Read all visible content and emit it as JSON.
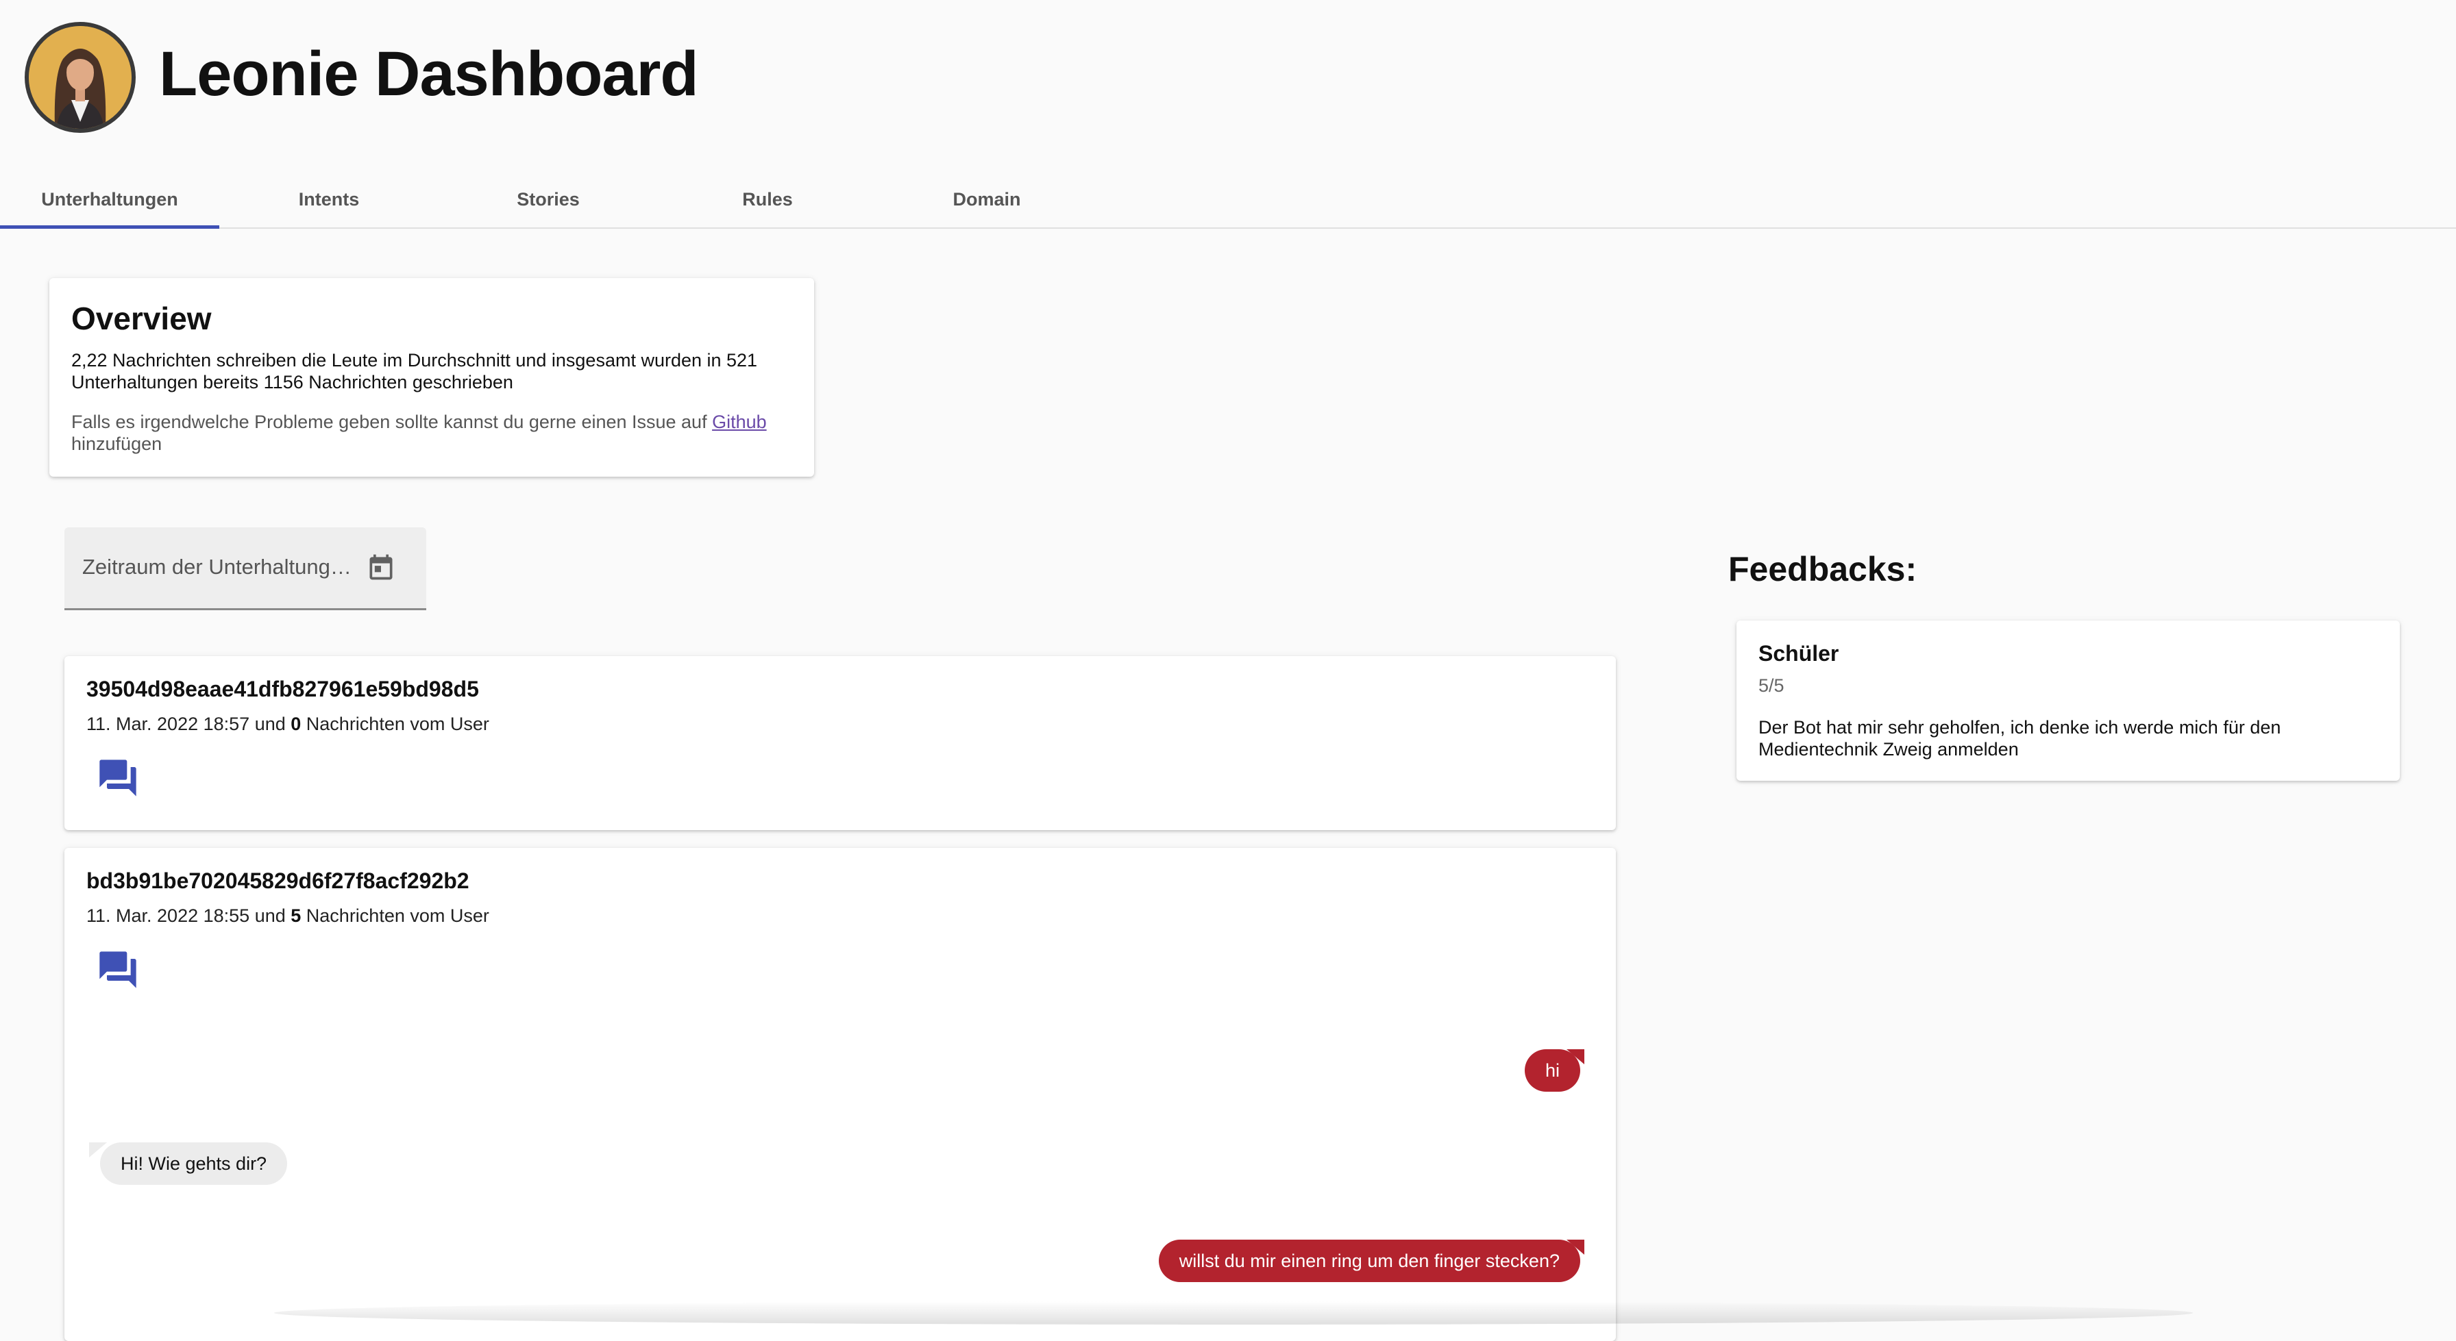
{
  "app": {
    "title": "Leonie Dashboard"
  },
  "tabs": [
    {
      "label": "Unterhaltungen",
      "active": true
    },
    {
      "label": "Intents",
      "active": false
    },
    {
      "label": "Stories",
      "active": false
    },
    {
      "label": "Rules",
      "active": false
    },
    {
      "label": "Domain",
      "active": false
    }
  ],
  "overview": {
    "title": "Overview",
    "stats_text": "2,22 Nachrichten schreiben die Leute im Durchschnitt und insgesamt wurden in 521 Unterhaltungen bereits 1156 Nachrichten geschrieben",
    "note_prefix": "Falls es irgendwelche Probleme geben sollte kannst du gerne einen Issue auf ",
    "note_link": "Github",
    "note_suffix": " hinzufügen"
  },
  "date_filter": {
    "placeholder": "Zeitraum der Unterhaltung…",
    "icon": "calendar-icon"
  },
  "conversations": [
    {
      "id": "39504d98eaae41dfb827961e59bd98d5",
      "datetime": "11. Mar. 2022 18:57",
      "connector": " und ",
      "count": "0",
      "count_suffix": " Nachrichten vom User",
      "messages": []
    },
    {
      "id": "bd3b91be702045829d6f27f8acf292b2",
      "datetime": "11. Mar. 2022 18:55",
      "connector": " und ",
      "count": "5",
      "count_suffix": " Nachrichten vom User",
      "messages": [
        {
          "sender": "user",
          "text": "hi"
        },
        {
          "sender": "bot",
          "text": "Hi! Wie gehts dir?"
        },
        {
          "sender": "user",
          "text": "willst du mir einen ring um den finger stecken?"
        }
      ]
    }
  ],
  "feedbacks": {
    "title": "Feedbacks:",
    "items": [
      {
        "role": "Schüler",
        "rating": "5/5",
        "text": "Der Bot hat mir sehr geholfen, ich denke ich werde mich für den Medientechnik Zweig anmelden"
      }
    ]
  },
  "colors": {
    "accent": "#3f51b5",
    "user_bubble": "#b3232e",
    "bot_bubble": "#ececec",
    "link": "#6a4aa8"
  }
}
